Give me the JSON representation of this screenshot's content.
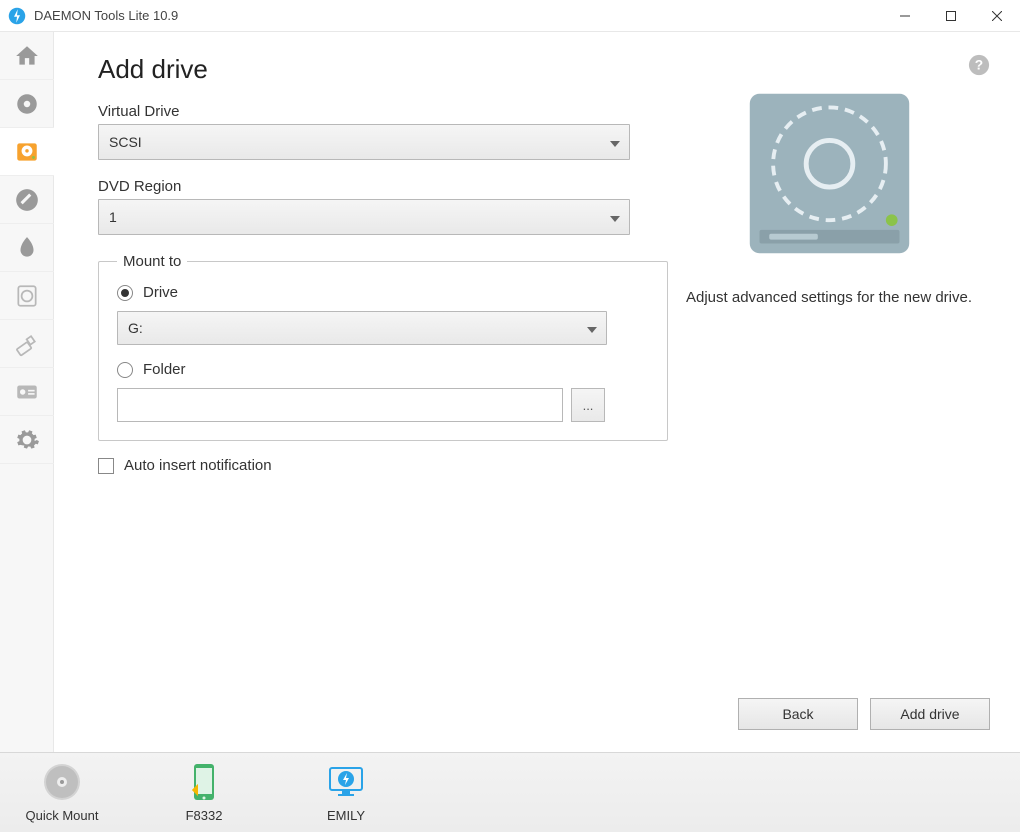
{
  "titlebar": {
    "title": "DAEMON Tools Lite 10.9"
  },
  "page": {
    "title": "Add drive"
  },
  "form": {
    "virtual_drive_label": "Virtual Drive",
    "virtual_drive_value": "SCSI",
    "dvd_region_label": "DVD Region",
    "dvd_region_value": "1",
    "mount_legend": "Mount to",
    "radio_drive_label": "Drive",
    "drive_letter_value": "G:",
    "radio_folder_label": "Folder",
    "folder_path_value": "",
    "browse_label": "...",
    "auto_insert_label": "Auto insert notification"
  },
  "info": {
    "text": "Adjust advanced settings for the new drive."
  },
  "actions": {
    "back": "Back",
    "add": "Add drive"
  },
  "devices": {
    "quick_mount": "Quick Mount",
    "dev1": "F8332",
    "dev2": "EMILY"
  }
}
